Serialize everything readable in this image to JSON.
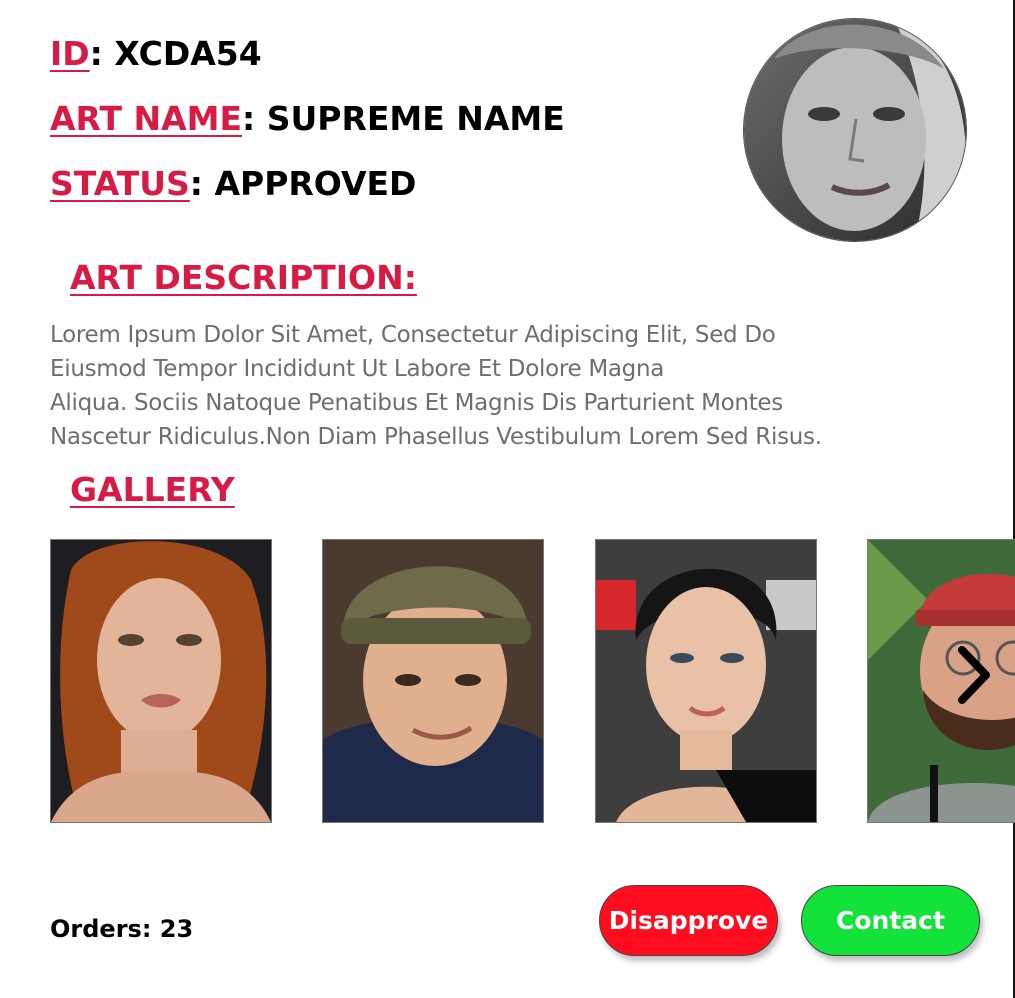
{
  "profile": {
    "id_label": "ID",
    "id_value": "XCDA54",
    "art_name_label": "ART NAME",
    "art_name_value": "SUPREME NAME",
    "status_label": "STATUS",
    "status_value": "APPROVED",
    "separator": ": "
  },
  "description": {
    "title": "ART DESCRIPTION:",
    "lines": [
      "Lorem Ipsum Dolor Sit Amet, Consectetur Adipiscing Elit, Sed Do",
      "Eiusmod Tempor Incididunt Ut Labore Et Dolore Magna",
      "Aliqua. Sociis Natoque Penatibus Et Magnis Dis Parturient Montes",
      "Nascetur Ridiculus.Non Diam Phasellus Vestibulum Lorem Sed Risus."
    ]
  },
  "gallery": {
    "title": "GALLERY",
    "next_icon": "chevron-right-icon"
  },
  "footer": {
    "orders_label": "Orders: 23",
    "disapprove_label": "Disapprove",
    "contact_label": "Contact"
  },
  "colors": {
    "accent": "#d81b45",
    "disapprove": "#ff0d1e",
    "contact": "#12e23a",
    "body_text": "#6e6e6e"
  }
}
